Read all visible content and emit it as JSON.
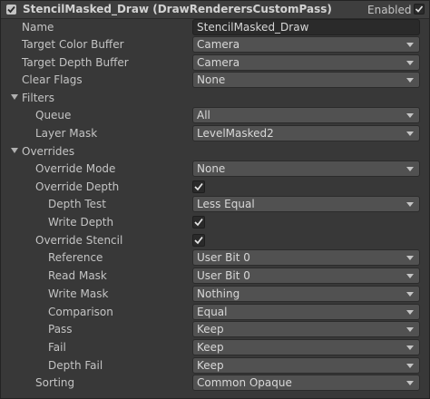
{
  "header": {
    "title": "StencilMasked_Draw (DrawRenderersCustomPass)",
    "enabled_label": "Enabled",
    "enabled": true
  },
  "rows": {
    "name": {
      "label": "Name",
      "value": "StencilMasked_Draw"
    },
    "target_color": {
      "label": "Target Color Buffer",
      "value": "Camera"
    },
    "target_depth": {
      "label": "Target Depth Buffer",
      "value": "Camera"
    },
    "clear_flags": {
      "label": "Clear Flags",
      "value": "None"
    },
    "filters": {
      "label": "Filters"
    },
    "queue": {
      "label": "Queue",
      "value": "All"
    },
    "layer_mask": {
      "label": "Layer Mask",
      "value": "LevelMasked2"
    },
    "overrides": {
      "label": "Overrides"
    },
    "override_mode": {
      "label": "Override Mode",
      "value": "None"
    },
    "override_depth": {
      "label": "Override Depth",
      "checked": true
    },
    "depth_test": {
      "label": "Depth Test",
      "value": "Less Equal"
    },
    "write_depth": {
      "label": "Write Depth",
      "checked": true
    },
    "override_stencil": {
      "label": "Override Stencil",
      "checked": true
    },
    "reference": {
      "label": "Reference",
      "value": "User Bit 0"
    },
    "read_mask": {
      "label": "Read Mask",
      "value": "User Bit 0"
    },
    "write_mask": {
      "label": "Write Mask",
      "value": "Nothing"
    },
    "comparison": {
      "label": "Comparison",
      "value": "Equal"
    },
    "pass": {
      "label": "Pass",
      "value": "Keep"
    },
    "fail": {
      "label": "Fail",
      "value": "Keep"
    },
    "depth_fail": {
      "label": "Depth Fail",
      "value": "Keep"
    },
    "sorting": {
      "label": "Sorting",
      "value": "Common Opaque"
    }
  },
  "icons": [
    "foldout-toggle-icon",
    "chevron-down-icon",
    "checkmark-icon"
  ],
  "colors": {
    "panel_bg": "#383838",
    "field_bg": "#515151",
    "text": "#c4c4c4"
  }
}
